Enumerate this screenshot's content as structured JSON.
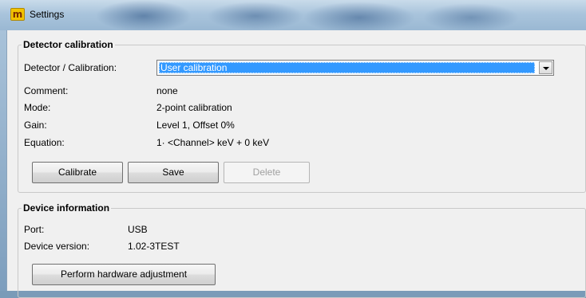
{
  "window": {
    "title": "Settings",
    "icon": "m-app-icon"
  },
  "detector_calibration": {
    "legend": "Detector calibration",
    "selector_label": "Detector / Calibration:",
    "selector_value": "User calibration",
    "fields": [
      {
        "label": "Comment:",
        "value": "none"
      },
      {
        "label": "Mode:",
        "value": "2-point calibration"
      },
      {
        "label": "Gain:",
        "value": "Level 1, Offset 0%"
      },
      {
        "label": "Equation:",
        "value": "1· <Channel> keV + 0 keV"
      }
    ],
    "buttons": {
      "calibrate": "Calibrate",
      "save": "Save",
      "delete": "Delete"
    }
  },
  "device_information": {
    "legend": "Device information",
    "fields": [
      {
        "label": "Port:",
        "value": "USB"
      },
      {
        "label": "Device version:",
        "value": "1.02-3TEST"
      }
    ],
    "adjust_button": "Perform hardware adjustment"
  },
  "colors": {
    "selection": "#3399ff",
    "window_bg": "#f0f0f0",
    "disabled_text": "#a0a0a0"
  }
}
